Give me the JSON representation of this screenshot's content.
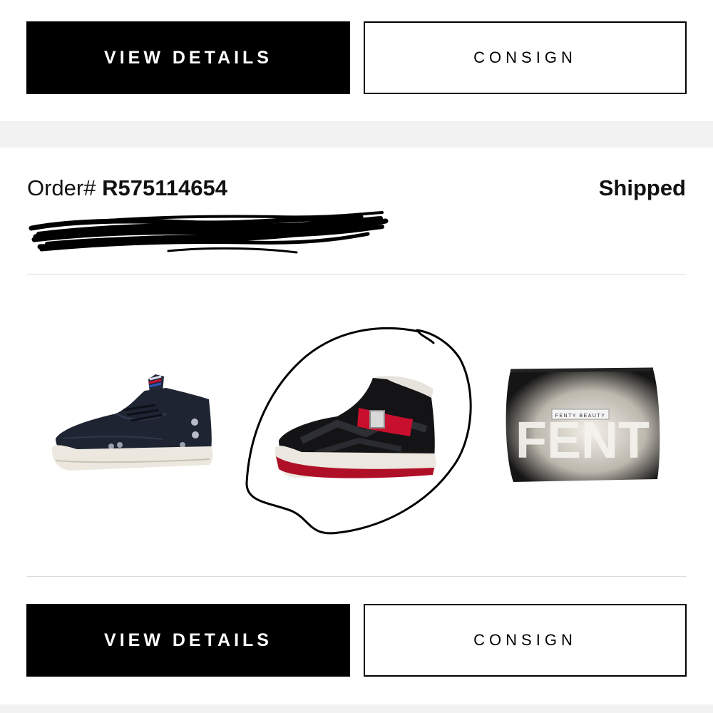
{
  "top_actions": {
    "view_details_label": "VIEW DETAILS",
    "consign_label": "CONSIGN"
  },
  "order": {
    "label_prefix": "Order# ",
    "number": "R575114654",
    "status": "Shipped"
  },
  "items": [
    {
      "name": "navy-leather-high-top-sneaker",
      "icon": "sneaker-icon"
    },
    {
      "name": "black-suede-high-top-sneaker-with-red-strap",
      "icon": "sneaker-icon"
    },
    {
      "name": "fenty-beauty-cosmetic-pouch",
      "icon": "pouch-icon",
      "brand_text": "FENTY BEAUTY",
      "print_text": "FENT"
    }
  ],
  "bottom_actions": {
    "view_details_label": "VIEW DETAILS",
    "consign_label": "CONSIGN"
  },
  "colors": {
    "primary_button": "#000000",
    "page_background": "#ffffff",
    "section_gap": "#f2f2f2",
    "accent_red": "#c8102e"
  }
}
